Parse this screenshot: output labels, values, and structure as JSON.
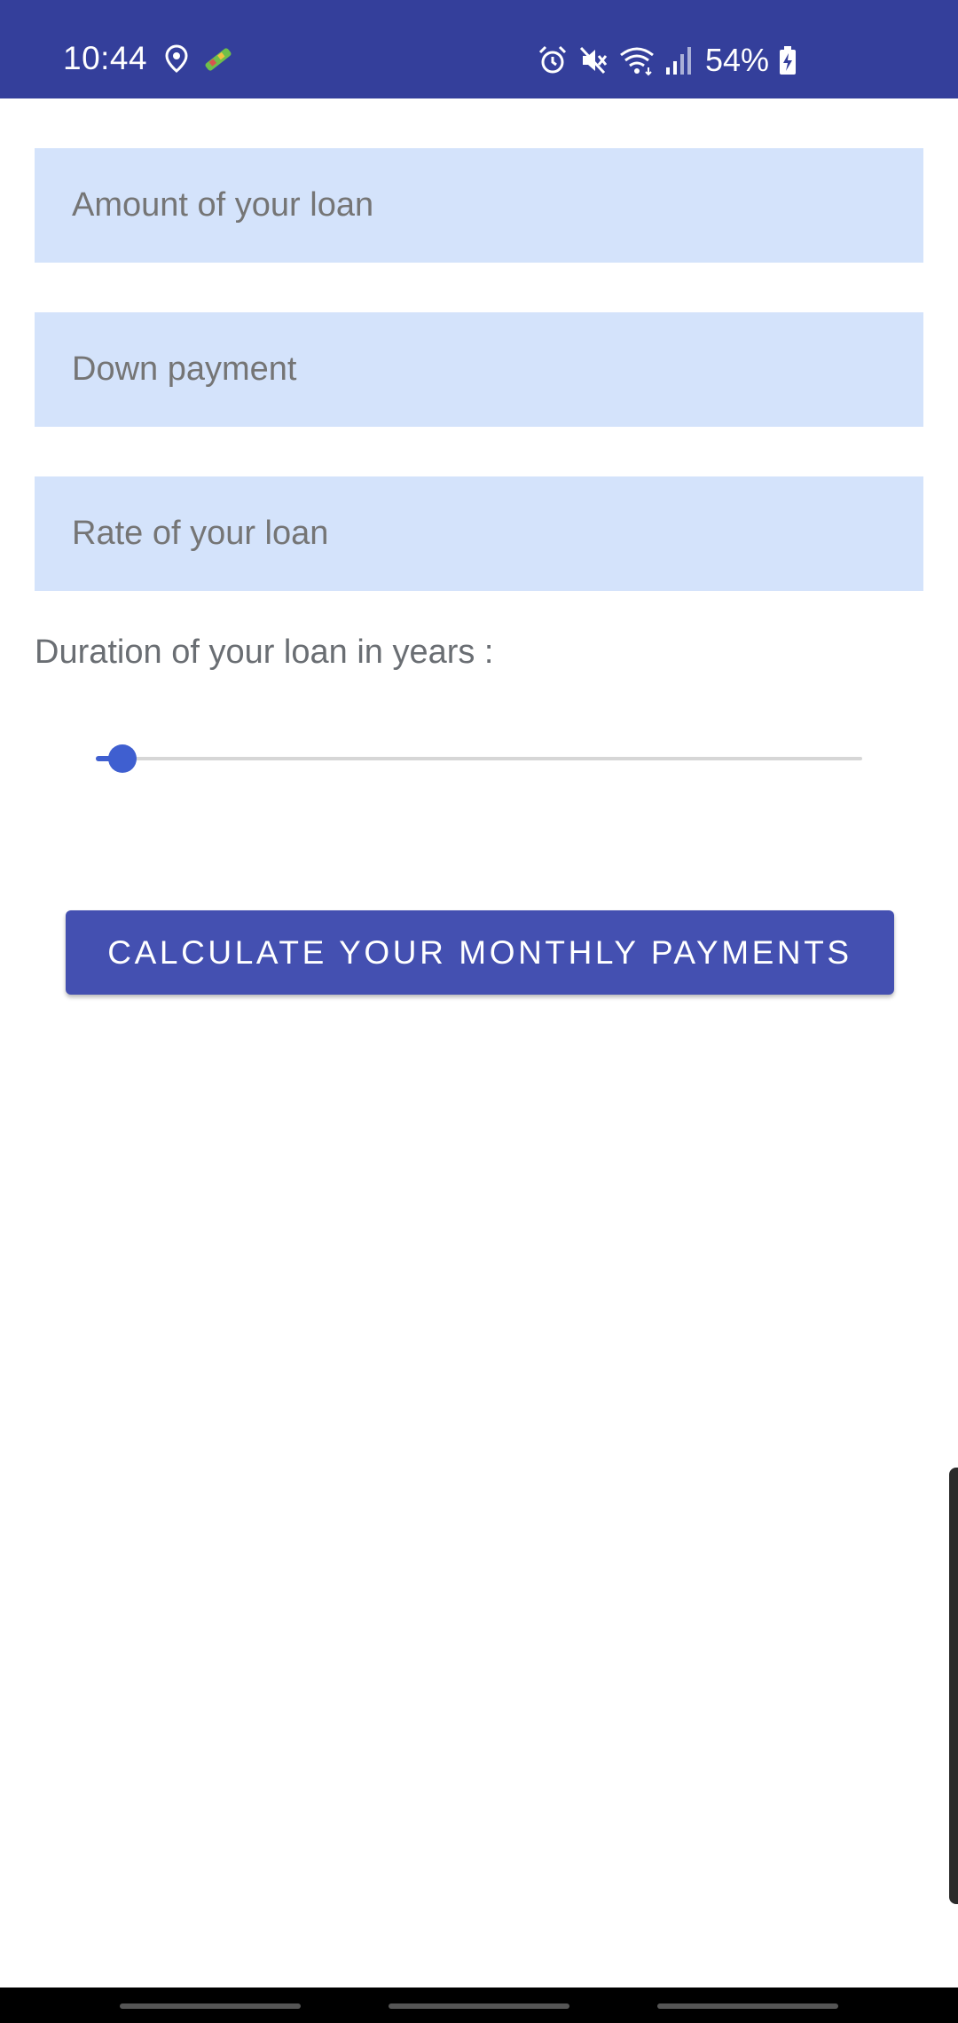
{
  "status_bar": {
    "time": "10:44",
    "battery_percent": "54%",
    "left_icons": [
      "location-icon",
      "app-notification-icon"
    ],
    "right_icons": [
      "alarm-icon",
      "mute-icon",
      "wifi-icon",
      "signal-icon",
      "battery-charging-icon"
    ]
  },
  "form": {
    "amount_placeholder": "Amount of your loan",
    "down_payment_placeholder": "Down payment",
    "rate_placeholder": "Rate of your loan",
    "duration_label": "Duration of your loan in years :"
  },
  "slider": {
    "value_fraction": 0.035
  },
  "actions": {
    "calculate_label": "CALCULATE YOUR MONTHLY PAYMENTS"
  },
  "colors": {
    "status_bar": "#343f9b",
    "field_background": "#d4e3fb",
    "accent": "#3f5fd0",
    "button": "#4450b1"
  }
}
